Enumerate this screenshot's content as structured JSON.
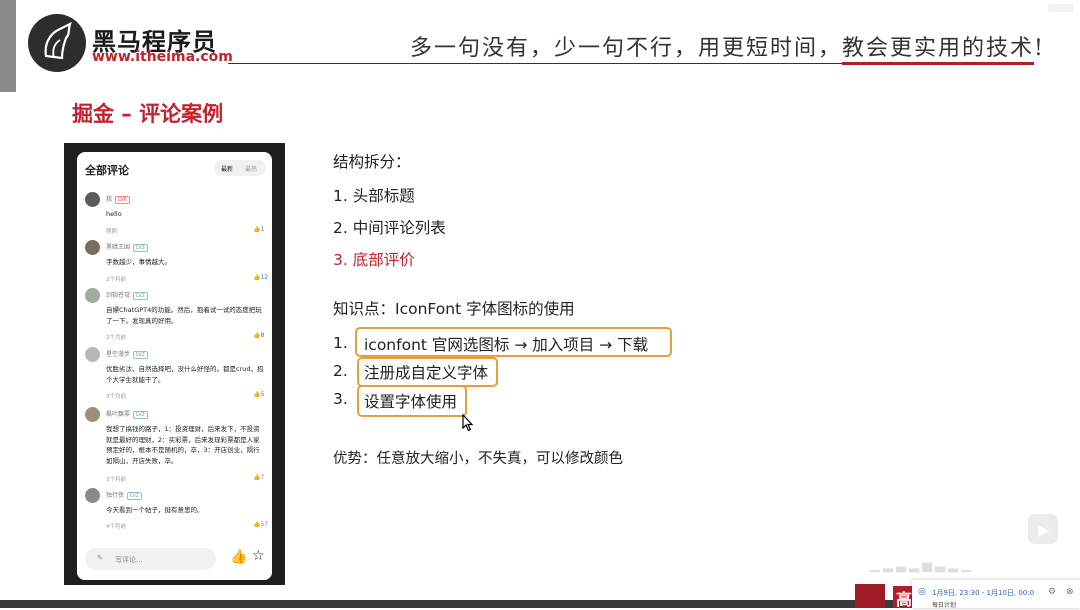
{
  "header": {
    "brand_name": "黑马程序员",
    "brand_url": "www.itheima.com",
    "slogan": "多一句没有，少一句不行，用更短时间，教会更实用的技术!"
  },
  "slide": {
    "title": "掘金 – 评论案例",
    "structure_heading": "结构拆分：",
    "structure_items": [
      "1.  头部标题",
      "2.  中间评论列表",
      "3.  底部评价"
    ],
    "knowledge_heading": "知识点：IconFont 字体图标的使用",
    "knowledge_items": [
      {
        "num": "1.",
        "text": "iconfont 官网选图标 → 加入项目 → 下载"
      },
      {
        "num": "2.",
        "text": "注册成自定义字体"
      },
      {
        "num": "3.",
        "text": "设置字体使用"
      }
    ],
    "advantage": "优势：任意放大缩小，不失真，可以修改颜色"
  },
  "phone": {
    "header_title": "全部评论",
    "sort_latest": "最新",
    "sort_hot": "最热",
    "comments": [
      {
        "name": "我",
        "level": "LV6",
        "text": "hello",
        "time": "刚刚",
        "likes": "1"
      },
      {
        "name": "黑暗王国",
        "level": "LV3",
        "text": "字数越少，事情越大。",
        "time": "2个月前",
        "likes": "12"
      },
      {
        "name": "剑指苍穹",
        "level": "LV2",
        "text": "自嫖ChatGPT4的功能。然后，抱着试一试的态度把玩了一下。发现真的好用。",
        "time": "2个月前",
        "likes": "8"
      },
      {
        "name": "星空漫步",
        "level": "LV2",
        "text": "优胜劣汰，自然选择吧，没什么好怪的。都是crud，招个大学生就能干了。",
        "time": "3个月前",
        "likes": "5"
      },
      {
        "name": "枫叶飘零",
        "level": "LV2",
        "text": "我想了搞钱的路子，1：投资理财，后来发下，不投资就是最好的理财，2：买彩票，后来发现彩票都是人家预定好的，根本不是随机的，卒，3：开店创业，隔行如隔山，开店失败，卒。",
        "time": "3个月前",
        "likes": "7"
      },
      {
        "name": "独行侠",
        "level": "LV2",
        "text": "今天看到一个帖子，挺有意思的。",
        "time": "4个月前",
        "likes": "57"
      }
    ],
    "write_placeholder": "写评论..."
  },
  "taskbar": {
    "corner_char": "高",
    "popup_time": "1月9日, 23:30 - 1月10日, 00:0",
    "popup_line2": "每日计划"
  },
  "colors": {
    "accent_red": "#c4202e",
    "highlight_box": "#e4a03a",
    "like_blue": "#3a6bd8"
  }
}
